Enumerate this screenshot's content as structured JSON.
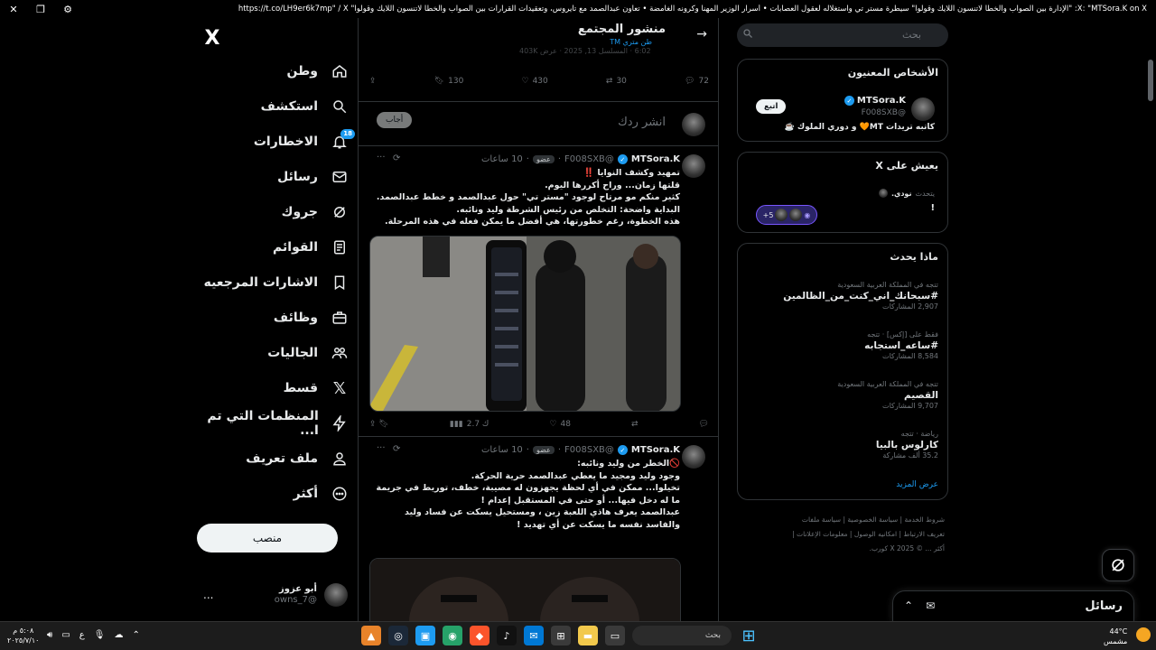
{
  "window": {
    "title": "X: \"MTSora.K on X: \"الإدارة بين الصواب والخطأ لاتنسون اللايك وقولوا\" سيطرة مستر تي واستغلاله لعقول العصابات • أسرار الوزير المهنا وكرونه الغامضة • تعاون عبدالصمد مع تايروس، وتعقيدات القرارات بين الصواب والخطأ لاتنسون اللايك وقولوا\" https://t.co/LH9er6k7mp\" / X",
    "close_glyph": "✕",
    "restore_glyph": "❐",
    "ext_glyph": "⚙"
  },
  "sidebar": {
    "logo": "X",
    "items": [
      {
        "label": "وطن",
        "icon": "home-icon"
      },
      {
        "label": "استكشف",
        "icon": "search-icon"
      },
      {
        "label": "الاخطارات",
        "icon": "bell-icon",
        "badge": "18"
      },
      {
        "label": "رسائل",
        "icon": "mail-icon"
      },
      {
        "label": "جروك",
        "icon": "grok-icon"
      },
      {
        "label": "القوائم",
        "icon": "list-icon"
      },
      {
        "label": "الاشارات المرجعيه",
        "icon": "bookmark-icon"
      },
      {
        "label": "وظائف",
        "icon": "briefcase-icon"
      },
      {
        "label": "الجاليات",
        "icon": "communities-icon"
      },
      {
        "label": "قسط",
        "icon": "x-premium-icon"
      },
      {
        "label": "المنظمات التي تم ا...",
        "icon": "lightning-icon"
      },
      {
        "label": "ملف تعريف",
        "icon": "person-icon"
      },
      {
        "label": "أكثر",
        "icon": "more-circle-icon"
      }
    ],
    "post_button": "منصب",
    "profile": {
      "name": "أبو عزوز",
      "handle": "@owns_7",
      "more": "..."
    }
  },
  "main": {
    "header": {
      "title": "منشور المجتمع",
      "subtitle": "طن متري TM",
      "ghost": "6:02 · المسلسل 13, 2025 · عرض 403K"
    },
    "top_actions": {
      "reply": "72",
      "retweet": "30",
      "like": "430",
      "bookmark": "130"
    },
    "reply_box": {
      "placeholder": "انشر ردك",
      "button": "أجاب"
    },
    "tweets": [
      {
        "name": "MTSora.K",
        "handle": "@F008SXB",
        "role": "عضو",
        "time": "10 ساعات",
        "body": "تمهيد وكشف النوايا ‼️\nقلتها زمان... وراح أكررها اليوم.\nكثير منكم مو مرتاح لوجود \"مستر تي\" حول عبدالصمد و خطط عبدالصمد.\nالبداية واضحة: التخلص من رئيس الشرطة وليد ونائبه.\nهذه الخطوة، رغم خطورتها، هي أفضل ما يمكن فعله في هذه المرحلة.",
        "actions": {
          "reply": "",
          "retweet": "",
          "like": "48",
          "views": "2.7 ك"
        }
      },
      {
        "name": "MTSora.K",
        "handle": "@F008SXB",
        "role": "عضو",
        "time": "10 ساعات",
        "body": "🚫الخطر من وليد ونائبه:\nوجود وليد ومجيد ما يعطي عبدالصمد حرية الحركة.\nتخيلوا... ممكن في أي لحظة يجهزون له مصيبة، خطف، توريط في جريمة ما له دخل فيها... أو حتى في المستقبل إعدام !\nعبدالصمد يعرف هاذي اللعبة زين ، ومستحيل يسكت عن فساد وليد والفاسد نفسه ما يسكت عن أي تهديد !"
      }
    ]
  },
  "rightbar": {
    "search_placeholder": "بحث",
    "relevant": {
      "title": "الأشخاص المعنيون",
      "name": "MTSora.K",
      "handle": "@F008SXB",
      "bio": "كاتبه تريدات MT🧡 و دوري الملوك ☕️",
      "follow": "اتبع"
    },
    "live": {
      "title": "يعيش على X",
      "host": "نودي.",
      "host_suffix": "يتحدث",
      "topic": "!",
      "more": "+5"
    },
    "trends": {
      "title": "ماذا يحدث",
      "items": [
        {
          "meta": "تتجه في المملكة العربية السعودية",
          "name": "#سبحانك_اني_كنت_من_الظالمين",
          "count": "2,907 المشاركات"
        },
        {
          "meta": "فقط على [إكس] · تتجه",
          "name": "#ساعه_استجابه",
          "count": "8,584 المشاركات"
        },
        {
          "meta": "تتجه في المملكة العربية السعودية",
          "name": "القصيم",
          "count": "9,707 المشاركات"
        },
        {
          "meta": "رياضة · تتجه",
          "name": "كارلوس بالبيا",
          "count": "35.2 ألف مشاركة"
        }
      ],
      "show_more": "عرض المزيد"
    },
    "footer": [
      "شروط الخدمة",
      "سياسة الخصوصية",
      "سياسة ملفات تعريف الارتباط",
      "امكانيه الوصول",
      "معلومات الإعلانات",
      "أكثر ...",
      "© 2025 X كورب."
    ]
  },
  "messages_drawer": {
    "title": "رسائل"
  },
  "taskbar": {
    "search": "بحث",
    "weather_temp": "44°C",
    "weather_text": "مشمس",
    "time": "٥:٠٨ م",
    "date": "٢٠٢٥/٧/١٠",
    "lang": "ع"
  },
  "colors": {
    "accent": "#1d9bf0",
    "bg": "#000000",
    "border": "#2f3336",
    "muted": "#71767b"
  }
}
